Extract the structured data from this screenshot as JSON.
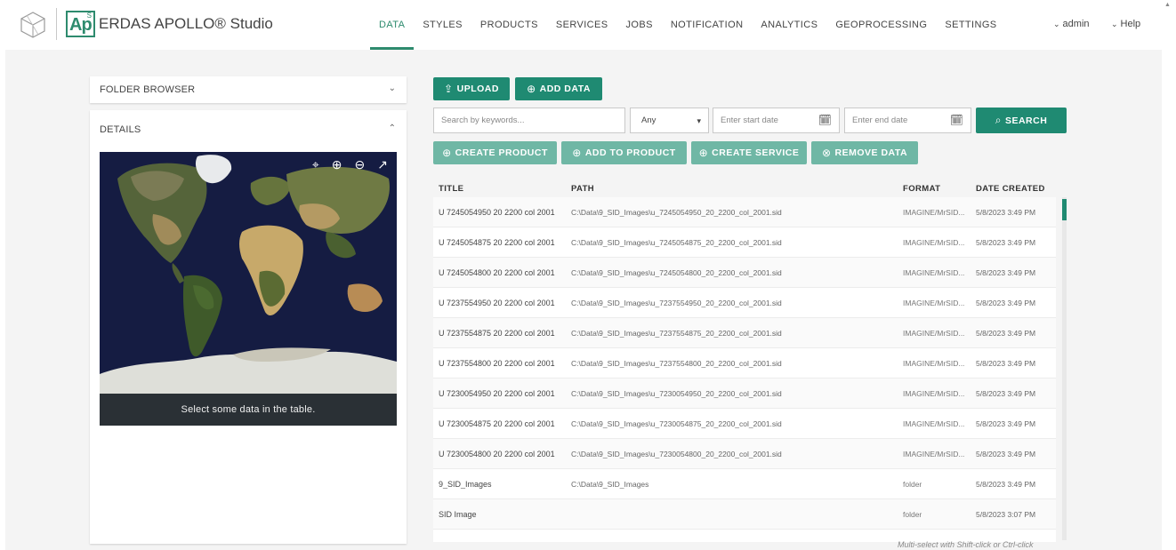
{
  "brand": {
    "logo_badge": "Ap",
    "logo_badge_sup": "S",
    "product": "ERDAS APOLLO® Studio"
  },
  "nav": [
    {
      "label": "DATA",
      "active": true
    },
    {
      "label": "STYLES"
    },
    {
      "label": "PRODUCTS"
    },
    {
      "label": "SERVICES"
    },
    {
      "label": "JOBS"
    },
    {
      "label": "NOTIFICATION"
    },
    {
      "label": "ANALYTICS"
    },
    {
      "label": "GEOPROCESSING"
    },
    {
      "label": "SETTINGS"
    }
  ],
  "user": {
    "name": "admin",
    "help": "Help"
  },
  "sidebar": {
    "folder_browser": "FOLDER BROWSER",
    "details": "DETAILS",
    "map_caption": "Select some data in the table."
  },
  "actions": {
    "upload": "UPLOAD",
    "add_data": "ADD DATA",
    "create_product": "CREATE PRODUCT",
    "add_to_product": "ADD TO PRODUCT",
    "create_service": "CREATE SERVICE",
    "remove_data": "REMOVE DATA"
  },
  "search": {
    "placeholder": "Search by keywords...",
    "type_value": "Any",
    "start_placeholder": "Enter start date",
    "end_placeholder": "Enter end date",
    "button": "SEARCH"
  },
  "table": {
    "columns": {
      "title": "TITLE",
      "path": "PATH",
      "format": "FORMAT",
      "date": "DATE CREATED"
    },
    "rows": [
      {
        "title": "U 7245054950 20 2200 col 2001",
        "path": "C:\\Data\\9_SID_Images\\u_7245054950_20_2200_col_2001.sid",
        "format": "IMAGINE/MrSID...",
        "date": "5/8/2023 3:49 PM"
      },
      {
        "title": "U 7245054875 20 2200 col 2001",
        "path": "C:\\Data\\9_SID_Images\\u_7245054875_20_2200_col_2001.sid",
        "format": "IMAGINE/MrSID...",
        "date": "5/8/2023 3:49 PM"
      },
      {
        "title": "U 7245054800 20 2200 col 2001",
        "path": "C:\\Data\\9_SID_Images\\u_7245054800_20_2200_col_2001.sid",
        "format": "IMAGINE/MrSID...",
        "date": "5/8/2023 3:49 PM"
      },
      {
        "title": "U 7237554950 20 2200 col 2001",
        "path": "C:\\Data\\9_SID_Images\\u_7237554950_20_2200_col_2001.sid",
        "format": "IMAGINE/MrSID...",
        "date": "5/8/2023 3:49 PM"
      },
      {
        "title": "U 7237554875 20 2200 col 2001",
        "path": "C:\\Data\\9_SID_Images\\u_7237554875_20_2200_col_2001.sid",
        "format": "IMAGINE/MrSID...",
        "date": "5/8/2023 3:49 PM"
      },
      {
        "title": "U 7237554800 20 2200 col 2001",
        "path": "C:\\Data\\9_SID_Images\\u_7237554800_20_2200_col_2001.sid",
        "format": "IMAGINE/MrSID...",
        "date": "5/8/2023 3:49 PM"
      },
      {
        "title": "U 7230054950 20 2200 col 2001",
        "path": "C:\\Data\\9_SID_Images\\u_7230054950_20_2200_col_2001.sid",
        "format": "IMAGINE/MrSID...",
        "date": "5/8/2023 3:49 PM"
      },
      {
        "title": "U 7230054875 20 2200 col 2001",
        "path": "C:\\Data\\9_SID_Images\\u_7230054875_20_2200_col_2001.sid",
        "format": "IMAGINE/MrSID...",
        "date": "5/8/2023 3:49 PM"
      },
      {
        "title": "U 7230054800 20 2200 col 2001",
        "path": "C:\\Data\\9_SID_Images\\u_7230054800_20_2200_col_2001.sid",
        "format": "IMAGINE/MrSID...",
        "date": "5/8/2023 3:49 PM"
      },
      {
        "title": "9_SID_Images",
        "path": "C:\\Data\\9_SID_Images",
        "format": "folder",
        "date": "5/8/2023 3:49 PM"
      },
      {
        "title": "SID Image",
        "path": "",
        "format": "folder",
        "date": "5/8/2023 3:07 PM"
      },
      {
        "title": "",
        "path": "",
        "format": "",
        "date": ""
      }
    ]
  },
  "hint": "Multi-select with Shift-click or Ctrl-click",
  "colors": {
    "accent": "#1f8a72",
    "accent_light": "#6fb7a5",
    "caption_bg": "#2a3035"
  },
  "icons": {
    "upload": "upload-icon",
    "add": "plus-circle-icon",
    "remove": "x-circle-icon",
    "search": "search-icon",
    "calendar": "calendar-icon",
    "map_locate": "locate-icon",
    "zoom_in": "zoom-in-icon",
    "zoom_out": "zoom-out-icon",
    "open": "external-link-icon"
  }
}
